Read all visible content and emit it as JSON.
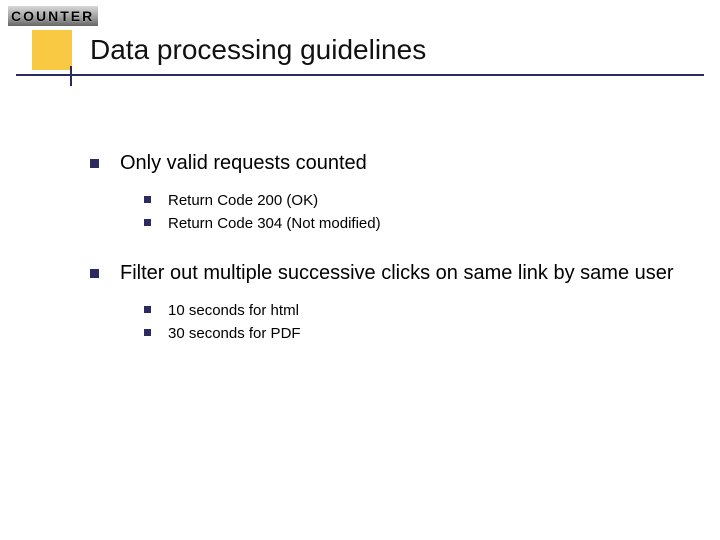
{
  "logo_text": "COUNTER",
  "title": "Data processing guidelines",
  "bullets": [
    {
      "text": "Only valid requests counted",
      "sub": [
        "Return Code 200 (OK)",
        "Return Code 304 (Not modified)"
      ]
    },
    {
      "text": "Filter out multiple successive clicks on same link by same user",
      "sub": [
        "10 seconds for html",
        "30 seconds for PDF"
      ]
    }
  ]
}
